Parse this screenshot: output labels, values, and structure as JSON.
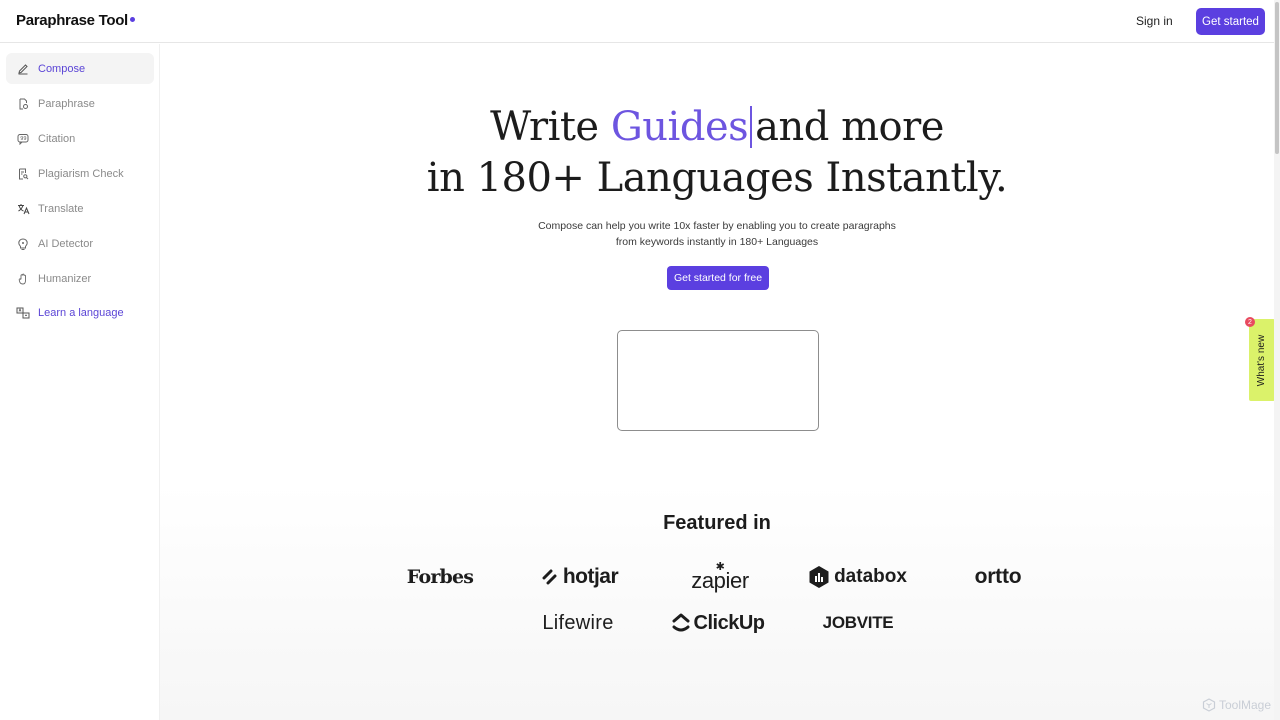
{
  "colors": {
    "accent": "#6d55e0",
    "button": "#5b3fe0",
    "whats_new_bg": "#dbf26a",
    "badge": "#e84a5f"
  },
  "header": {
    "logo_text": "Paraphrase Tool",
    "sign_in": "Sign in",
    "get_started": "Get started"
  },
  "sidebar": {
    "items": [
      {
        "label": "Compose",
        "icon": "pencil-icon"
      },
      {
        "label": "Paraphrase",
        "icon": "document-refresh-icon"
      },
      {
        "label": "Citation",
        "icon": "quote-icon"
      },
      {
        "label": "Plagiarism Check",
        "icon": "document-search-icon"
      },
      {
        "label": "Translate",
        "icon": "translate-icon"
      },
      {
        "label": "AI Detector",
        "icon": "ai-bulb-icon"
      },
      {
        "label": "Humanizer",
        "icon": "hand-icon"
      },
      {
        "label": "Learn a language",
        "icon": "language-cards-icon"
      }
    ]
  },
  "hero": {
    "line1_prefix": "Write ",
    "line1_highlight": "Guides",
    "line1_suffix": "and more",
    "line2": "in 180+ Languages Instantly.",
    "sub_line1": "Compose can help you write 10x faster by enabling you to create paragraphs",
    "sub_line2": "from keywords instantly in 180+ Languages",
    "cta": "Get started for free"
  },
  "featured": {
    "title": "Featured in",
    "brands": [
      "Forbes",
      "hotjar",
      "zapier",
      "databox",
      "ortto",
      "Lifewire",
      "ClickUp",
      "JOBVITE"
    ]
  },
  "whats_new": {
    "label": "What's new",
    "badge": "2"
  },
  "watermark": "ToolMage"
}
